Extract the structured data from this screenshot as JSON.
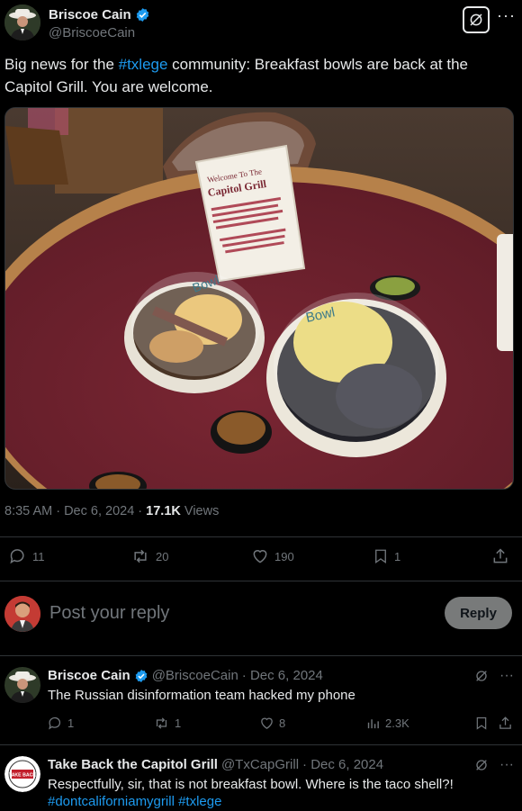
{
  "author": {
    "name": "Briscoe Cain",
    "handle": "@BriscoeCain"
  },
  "post": {
    "text_before": "Big news for the ",
    "hashtag": "#txlege",
    "text_after": " community: Breakfast bowls are back at the Capitol Grill. You are welcome.",
    "photo_sign": [
      "Welcome To The",
      "Capitol Grill"
    ],
    "photo_lid_1": "Bowl",
    "photo_lid_2": "Bowl",
    "time": "8:35 AM · Dec 6, 2024 · ",
    "views_count": "17.1K",
    "views_label": " Views"
  },
  "actions": {
    "replies": "11",
    "reposts": "20",
    "likes": "190",
    "bookmarks": "1"
  },
  "composer": {
    "placeholder": "Post your reply",
    "button": "Reply"
  },
  "replies": [
    {
      "name": "Briscoe Cain",
      "handle": "@BriscoeCain",
      "date": "· Dec 6, 2024",
      "text": "The Russian disinformation team hacked my phone",
      "replies": "1",
      "reposts": "1",
      "likes": "8",
      "views": "2.3K"
    },
    {
      "name": "Take Back the Capitol Grill",
      "handle": "@TxCapGrill",
      "date": "· Dec 6, 2024",
      "text": "Respectfully, sir, that is not breakfast bowl. Where is the taco shell?!",
      "hashtags": "#dontcalifornia​mygrill #txlege",
      "avatar_text": "TAKE BACK"
    }
  ],
  "colors": {
    "background": "#000000",
    "text": "#e7e9ea",
    "muted": "#71767b",
    "link": "#1d9bf0",
    "verified": "#1d9bf0",
    "divider": "#2f3336"
  }
}
